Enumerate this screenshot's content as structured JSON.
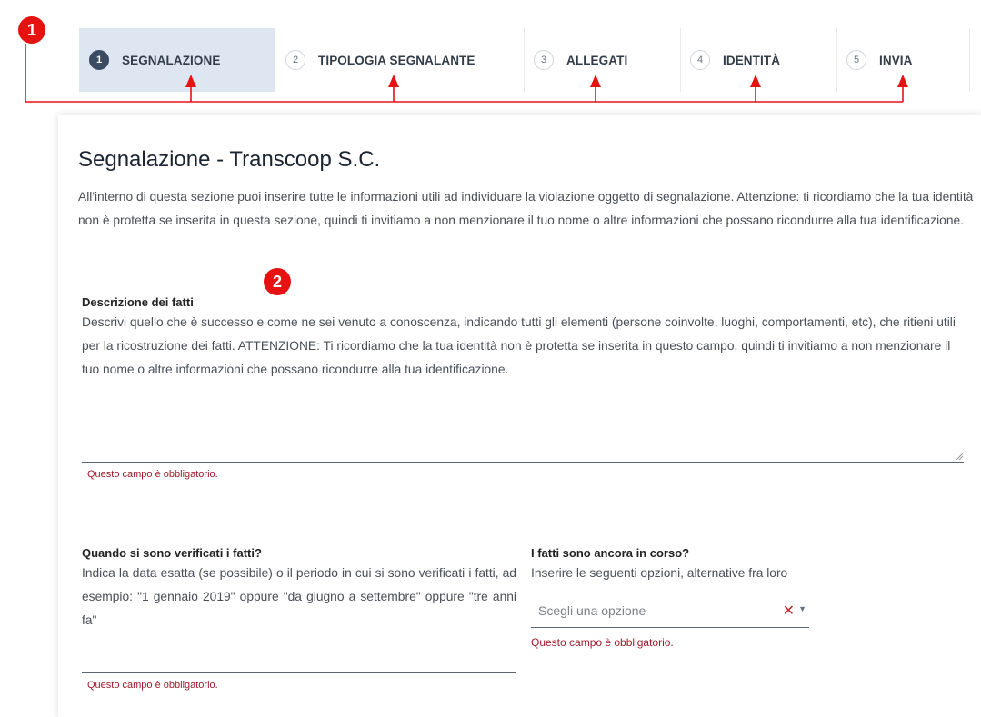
{
  "callouts": [
    "1",
    "2"
  ],
  "steps": [
    {
      "num": "1",
      "label": "SEGNALAZIONE"
    },
    {
      "num": "2",
      "label": "TIPOLOGIA SEGNALANTE"
    },
    {
      "num": "3",
      "label": "ALLEGATI"
    },
    {
      "num": "4",
      "label": "IDENTITÀ"
    },
    {
      "num": "5",
      "label": "INVIA"
    }
  ],
  "colors": {
    "accent": "#e61212",
    "active_step": "#dde6f1",
    "error": "#9e1a2a"
  },
  "page": {
    "title": "Segnalazione - Transcoop S.C.",
    "intro": "All'interno di questa sezione puoi inserire tutte le informazioni utili ad individuare la violazione oggetto di segnalazione. Attenzione: ti ricordiamo che la tua identità non è protetta se inserita in questa sezione, quindi ti invitiamo a non menzionare il tuo nome o altre informazioni che possano ricondurre alla tua identificazione."
  },
  "fields": {
    "descrizione": {
      "label": "Descrizione dei fatti",
      "help": "Descrivi quello che è successo e come ne sei venuto a conoscenza, indicando tutti gli elementi (persone coinvolte, luoghi, comportamenti, etc), che ritieni utili per la ricostruzione dei fatti. ATTENZIONE: Ti ricordiamo che la tua identità non è protetta se inserita in questo campo, quindi ti invitiamo a non menzionare il tuo nome o altre informazioni che possano ricondurre alla tua identificazione.",
      "error": "Questo campo è obbligatorio."
    },
    "quando": {
      "label": "Quando si sono verificati i fatti?",
      "help": "Indica la data esatta (se possibile) o il periodo in cui si sono verificati i fatti, ad esempio: \"1 gennaio 2019\" oppure \"da giugno a settembre\" oppure \"tre anni fa\"",
      "error": "Questo campo è obbligatorio."
    },
    "in_corso": {
      "label": "I fatti sono ancora in corso?",
      "help": "Inserire le seguenti opzioni, alternative fra loro",
      "placeholder": "Scegli una opzione",
      "clear_glyph": "✕",
      "caret_glyph": "▼",
      "error": "Questo campo è obbligatorio."
    }
  }
}
